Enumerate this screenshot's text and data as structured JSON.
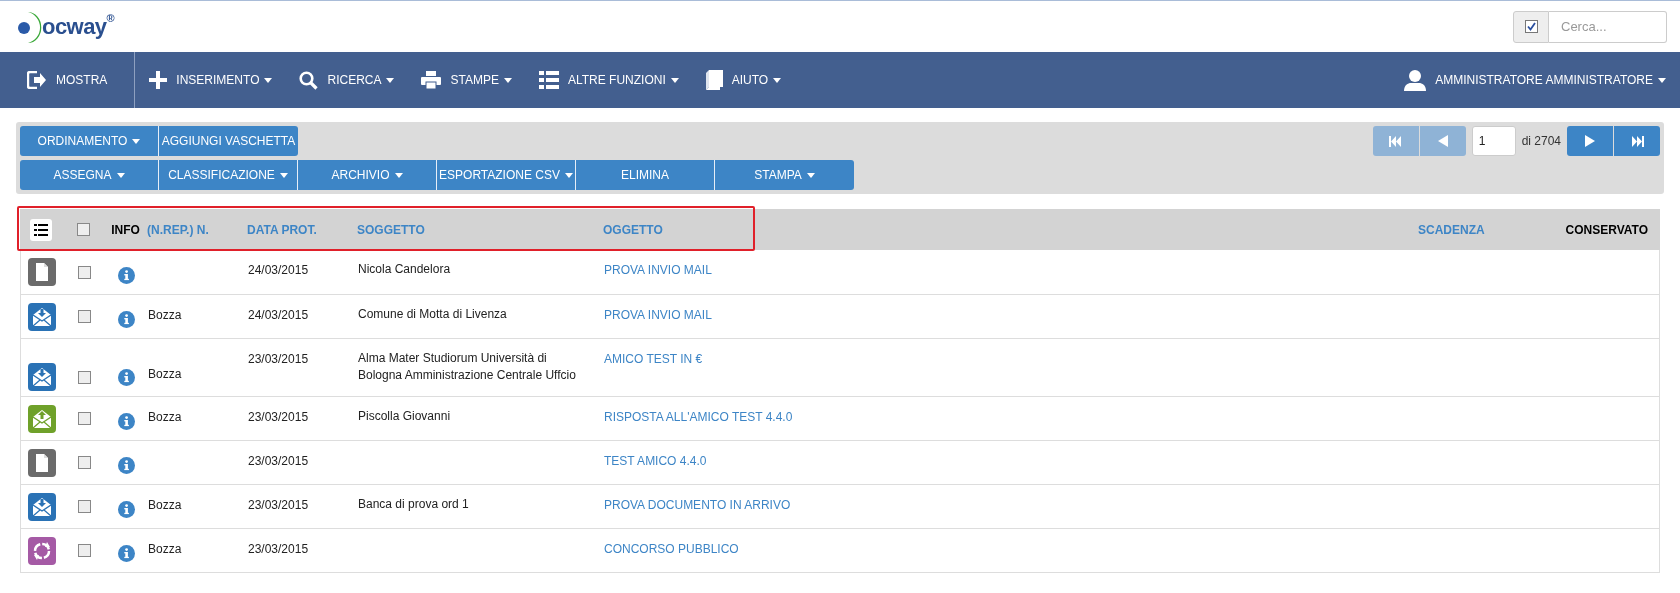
{
  "logo": {
    "text": "ocway",
    "mark": "®"
  },
  "search": {
    "checked": true,
    "placeholder": "Cerca..."
  },
  "nav": [
    {
      "kind": "exit",
      "label": "MOSTRA",
      "dropdown": false
    },
    {
      "kind": "plus",
      "label": "INSERIMENTO",
      "dropdown": true
    },
    {
      "kind": "search",
      "label": "RICERCA",
      "dropdown": true
    },
    {
      "kind": "print",
      "label": "STAMPE",
      "dropdown": true
    },
    {
      "kind": "list",
      "label": "ALTRE FUNZIONI",
      "dropdown": true
    },
    {
      "kind": "book",
      "label": "AIUTO",
      "dropdown": true
    }
  ],
  "user": {
    "label": "AMMINISTRATORE AMMINISTRATORE",
    "dropdown": true
  },
  "toolbar_1": [
    {
      "label": "ORDINAMENTO",
      "dropdown": true
    },
    {
      "label": "AGGIUNGI VASCHETTA",
      "dropdown": false
    }
  ],
  "toolbar_2": [
    {
      "label": "ASSEGNA",
      "dropdown": true
    },
    {
      "label": "CLASSIFICAZIONE",
      "dropdown": true
    },
    {
      "label": "ARCHIVIO",
      "dropdown": true
    },
    {
      "label": "ESPORTAZIONE CSV",
      "dropdown": true
    },
    {
      "label": "ELIMINA",
      "dropdown": false
    },
    {
      "label": "STAMPA",
      "dropdown": true
    }
  ],
  "pager": {
    "first_disabled": true,
    "prev_disabled": true,
    "page": "1",
    "total": "di 2704",
    "next_disabled": false,
    "last_disabled": false
  },
  "table": {
    "highlighted": true,
    "select_all_checked": false,
    "columns": [
      {
        "label": "INFO",
        "sortable": false
      },
      {
        "label": "(N.REP.) N.",
        "sortable": true
      },
      {
        "label": "DATA PROT.",
        "sortable": true
      },
      {
        "label": "SOGGETTO",
        "sortable": true
      },
      {
        "label": "OGGETTO",
        "sortable": true
      },
      {
        "label": "SCADENZA",
        "sortable": true
      },
      {
        "label": "CONSERVATO",
        "sortable": false
      }
    ],
    "rows": [
      {
        "kind": "document",
        "checked": false,
        "number": "",
        "date": "24/03/2015",
        "subject": "Nicola Candelora",
        "object": "PROVA INVIO MAIL"
      },
      {
        "kind": "mail_in",
        "checked": false,
        "number": "Bozza",
        "date": "24/03/2015",
        "subject": "Comune di Motta di Livenza",
        "object": "PROVA INVIO MAIL"
      },
      {
        "kind": "mail_in",
        "checked": false,
        "number": "Bozza",
        "date": "23/03/2015",
        "subject": "Alma Mater Studiorum Università di Bologna Amministrazione Centrale Uffcio",
        "object": "AMICO TEST IN €"
      },
      {
        "kind": "mail_out",
        "checked": false,
        "number": "Bozza",
        "date": "23/03/2015",
        "subject": "Piscolla Giovanni",
        "object": "RISPOSTA ALL'AMICO TEST 4.4.0"
      },
      {
        "kind": "document",
        "checked": false,
        "number": "",
        "date": "23/03/2015",
        "subject": "",
        "object": "TEST AMICO 4.4.0"
      },
      {
        "kind": "mail_in",
        "checked": false,
        "number": "Bozza",
        "date": "23/03/2015",
        "subject": "Banca di prova ord 1",
        "object": "PROVA DOCUMENTO IN ARRIVO"
      },
      {
        "kind": "cycle",
        "checked": false,
        "number": "Bozza",
        "date": "23/03/2015",
        "subject": "",
        "object": "CONCORSO PUBBLICO"
      }
    ]
  }
}
